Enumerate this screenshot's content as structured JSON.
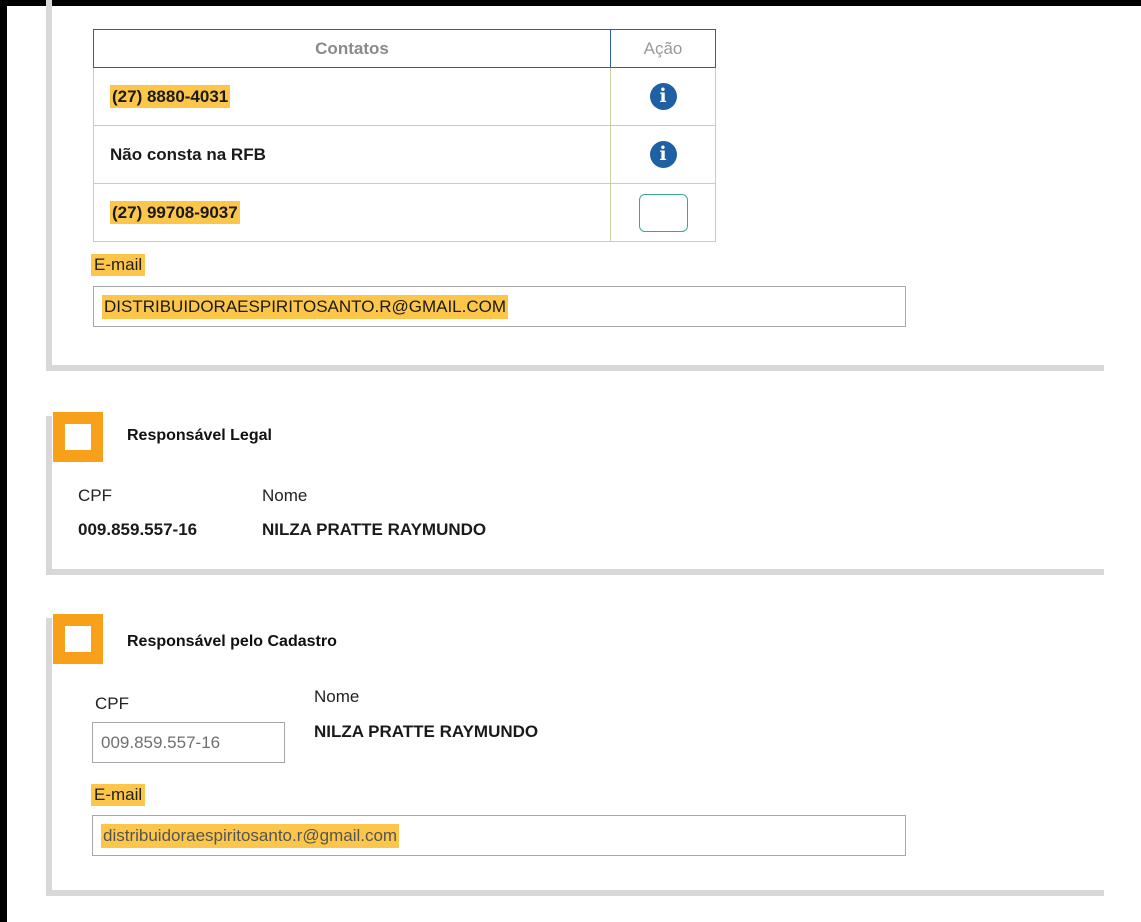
{
  "contacts": {
    "header_contacts": "Contatos",
    "header_action": "Ação",
    "rows": [
      {
        "text": "(27) 8880-4031",
        "highlighted": true,
        "action_icon": "info-icon"
      },
      {
        "text": "Não consta na RFB",
        "highlighted": false,
        "action_icon": "info-icon"
      },
      {
        "text": "(27) 99708-9037",
        "highlighted": true,
        "action_icon": "empty-button"
      }
    ],
    "email_label": "E-mail",
    "email_value": "DISTRIBUIDORAESPIRITOSANTO.R@GMAIL.COM"
  },
  "legal": {
    "title": "Responsável Legal",
    "cpf_label": "CPF",
    "cpf_value": "009.859.557-16",
    "nome_label": "Nome",
    "nome_value": "NILZA PRATTE RAYMUNDO"
  },
  "cadastro": {
    "title": "Responsável pelo Cadastro",
    "cpf_label": "CPF",
    "cpf_value": "009.859.557-16",
    "nome_label": "Nome",
    "nome_value": "NILZA PRATTE RAYMUNDO",
    "email_label": "E-mail",
    "email_value": "distribuidoraespiritosanto.r@gmail.com"
  },
  "colors": {
    "highlight": "#fcc64a",
    "section_icon": "#f9a01b",
    "info_icon": "#1f5fa3",
    "table_header_border": "#2f5e9e"
  }
}
